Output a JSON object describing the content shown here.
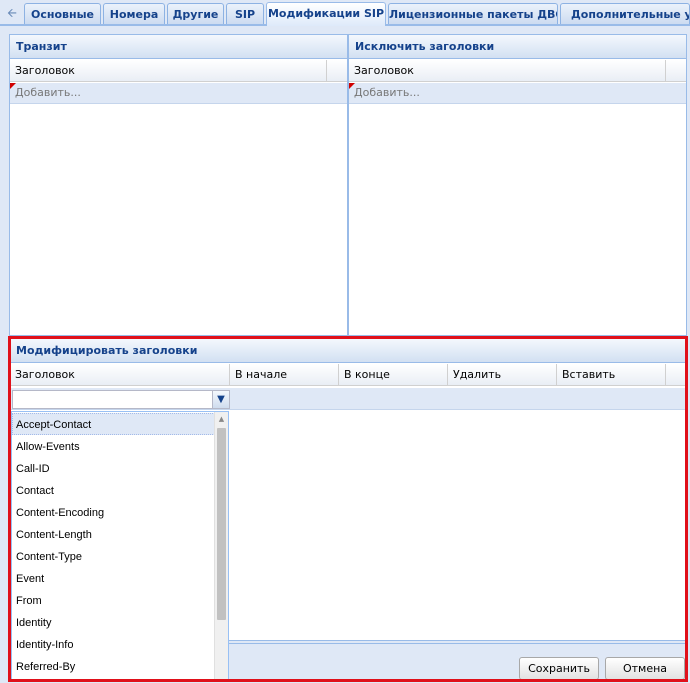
{
  "tabs": [
    {
      "label": "Основные"
    },
    {
      "label": "Номера"
    },
    {
      "label": "Другие"
    },
    {
      "label": "SIP"
    },
    {
      "label": "Модификации SIP",
      "active": true
    },
    {
      "label": "Лицензионные пакеты ДВО"
    },
    {
      "label": "Дополнительные у"
    }
  ],
  "transit": {
    "title": "Транзит",
    "column": "Заголовок",
    "add_placeholder": "Добавить..."
  },
  "exclude": {
    "title": "Исключить заголовки",
    "column": "Заголовок",
    "add_placeholder": "Добавить..."
  },
  "modify": {
    "title": "Модифицировать заголовки",
    "columns": [
      "Заголовок",
      "В начале",
      "В конце",
      "Удалить",
      "Вставить"
    ],
    "combo_value": "",
    "options": [
      "Accept-Contact",
      "Allow-Events",
      "Call-ID",
      "Contact",
      "Content-Encoding",
      "Content-Length",
      "Content-Type",
      "Event",
      "From",
      "Identity",
      "Identity-Info",
      "Referred-By"
    ],
    "selected_index": 0
  },
  "buttons": {
    "save": "Сохранить",
    "cancel": "Отмена"
  },
  "icons": {
    "tab_scroll_left": "arrow-left-icon",
    "combo_trigger": "chevron-down-icon",
    "scroll_up": "scroll-up-arrow-icon"
  },
  "colors": {
    "accent": "#15428b",
    "panel_border": "#99bbe8",
    "background": "#dfe8f6",
    "highlight": "#e0101a"
  }
}
